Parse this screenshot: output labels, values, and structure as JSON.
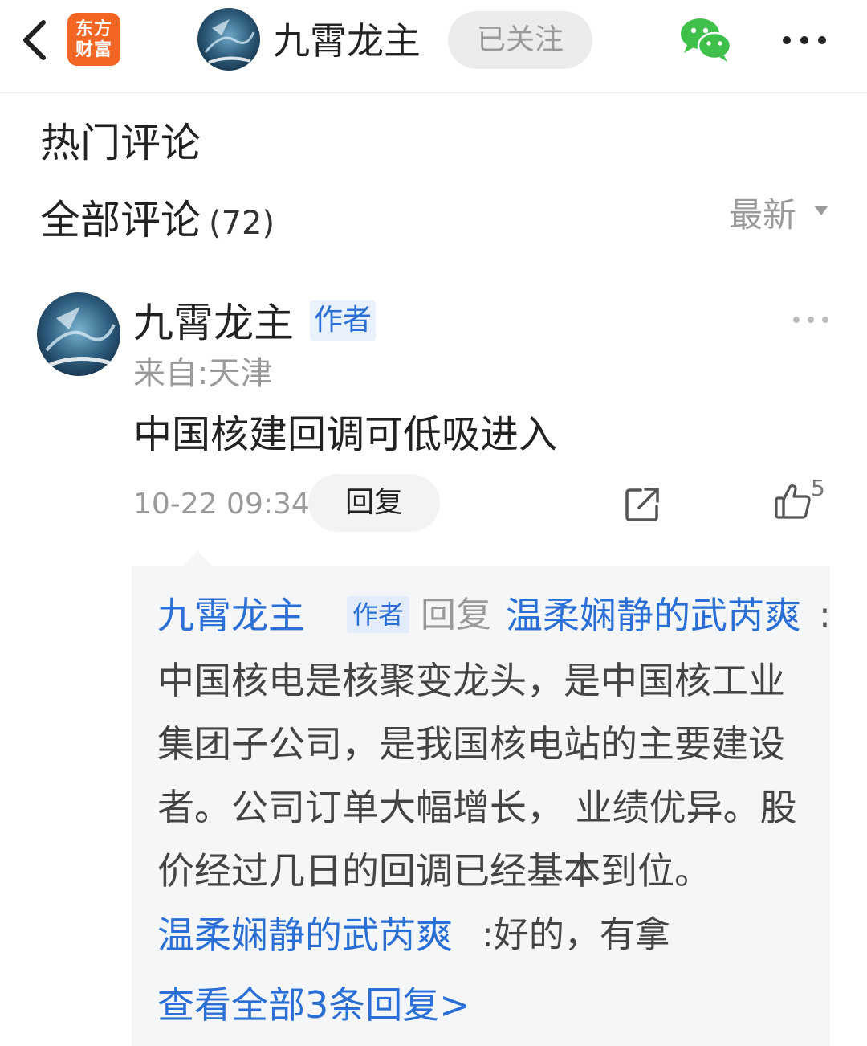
{
  "header": {
    "app_logo_text": "东方\n财富",
    "title": "九霄龙主",
    "follow_label": "已关注",
    "colors": {
      "brand_orange": "#f26522",
      "link_blue": "#2a6fd6",
      "wechat_green": "#3fc04a"
    }
  },
  "sections": {
    "hot_title": "热门评论",
    "all_title": "全部评论",
    "all_count": "(72)",
    "sort_label": "最新"
  },
  "comment": {
    "author": "九霄龙主",
    "badge": "作者",
    "location": "来自:天津",
    "text": "中国核建回调可低吸进入",
    "time": "10-22 09:34",
    "reply_button": "回复",
    "like_count": "5"
  },
  "replies": {
    "first": {
      "author": "九霄龙主",
      "badge": "作者",
      "reply_word": "回复",
      "target": "温柔娴静的武芮爽",
      "colon": ":",
      "body": "中国核电是核聚变龙头，是中国核工业集团子公司，是我国核电站的主要建设者。公司订单大幅增长， 业绩优异。股价经过几日的回调已经基本到位。"
    },
    "second": {
      "author": "温柔娴静的武芮爽",
      "text": ":好的，有拿"
    },
    "view_all": "查看全部3条回复>"
  }
}
